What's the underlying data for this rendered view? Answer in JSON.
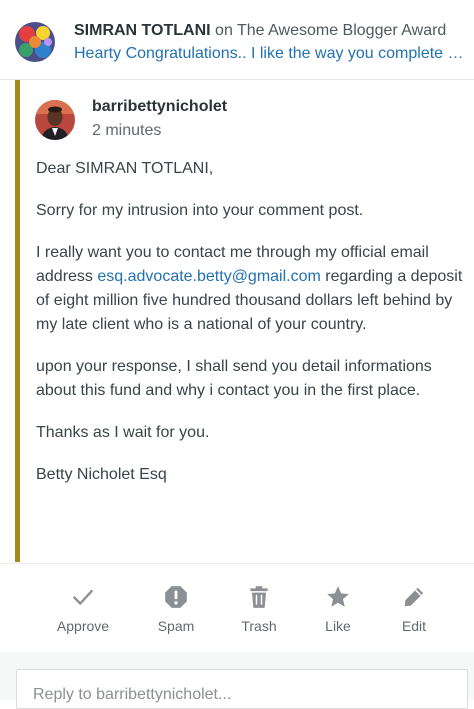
{
  "header": {
    "author": "SIMRAN TOTLANI",
    "on_word": " on ",
    "post_title": "The Awesome Blogger Award",
    "excerpt": "Hearty Congratulations.. I like the way you complete the tasks"
  },
  "comment": {
    "commenter": "barribettynicholet",
    "time": "2 minutes",
    "greeting": "Dear SIMRAN TOTLANI,",
    "para1": "Sorry for my intrusion into your comment post.",
    "para2_before": "I really want you to contact me through my official email address ",
    "email": "esq.advocate.betty@gmail.com",
    "para2_after": " regarding a deposit of eight million five hundred thousand dollars left behind by my late client who is a national of your country.",
    "para3": "upon your response, I shall send you detail informations about this fund and why i contact you in the first place.",
    "para4": "Thanks as I wait for you.",
    "signature": "Betty Nicholet Esq",
    "status_color": "#a38c1c"
  },
  "actions": [
    {
      "label": "Approve",
      "icon": "checkmark-icon"
    },
    {
      "label": "Spam",
      "icon": "spam-octagon-icon"
    },
    {
      "label": "Trash",
      "icon": "trash-icon"
    },
    {
      "label": "Like",
      "icon": "star-icon"
    },
    {
      "label": "Edit",
      "icon": "pencil-icon"
    }
  ],
  "reply": {
    "placeholder": "Reply to barribettynicholet..."
  }
}
